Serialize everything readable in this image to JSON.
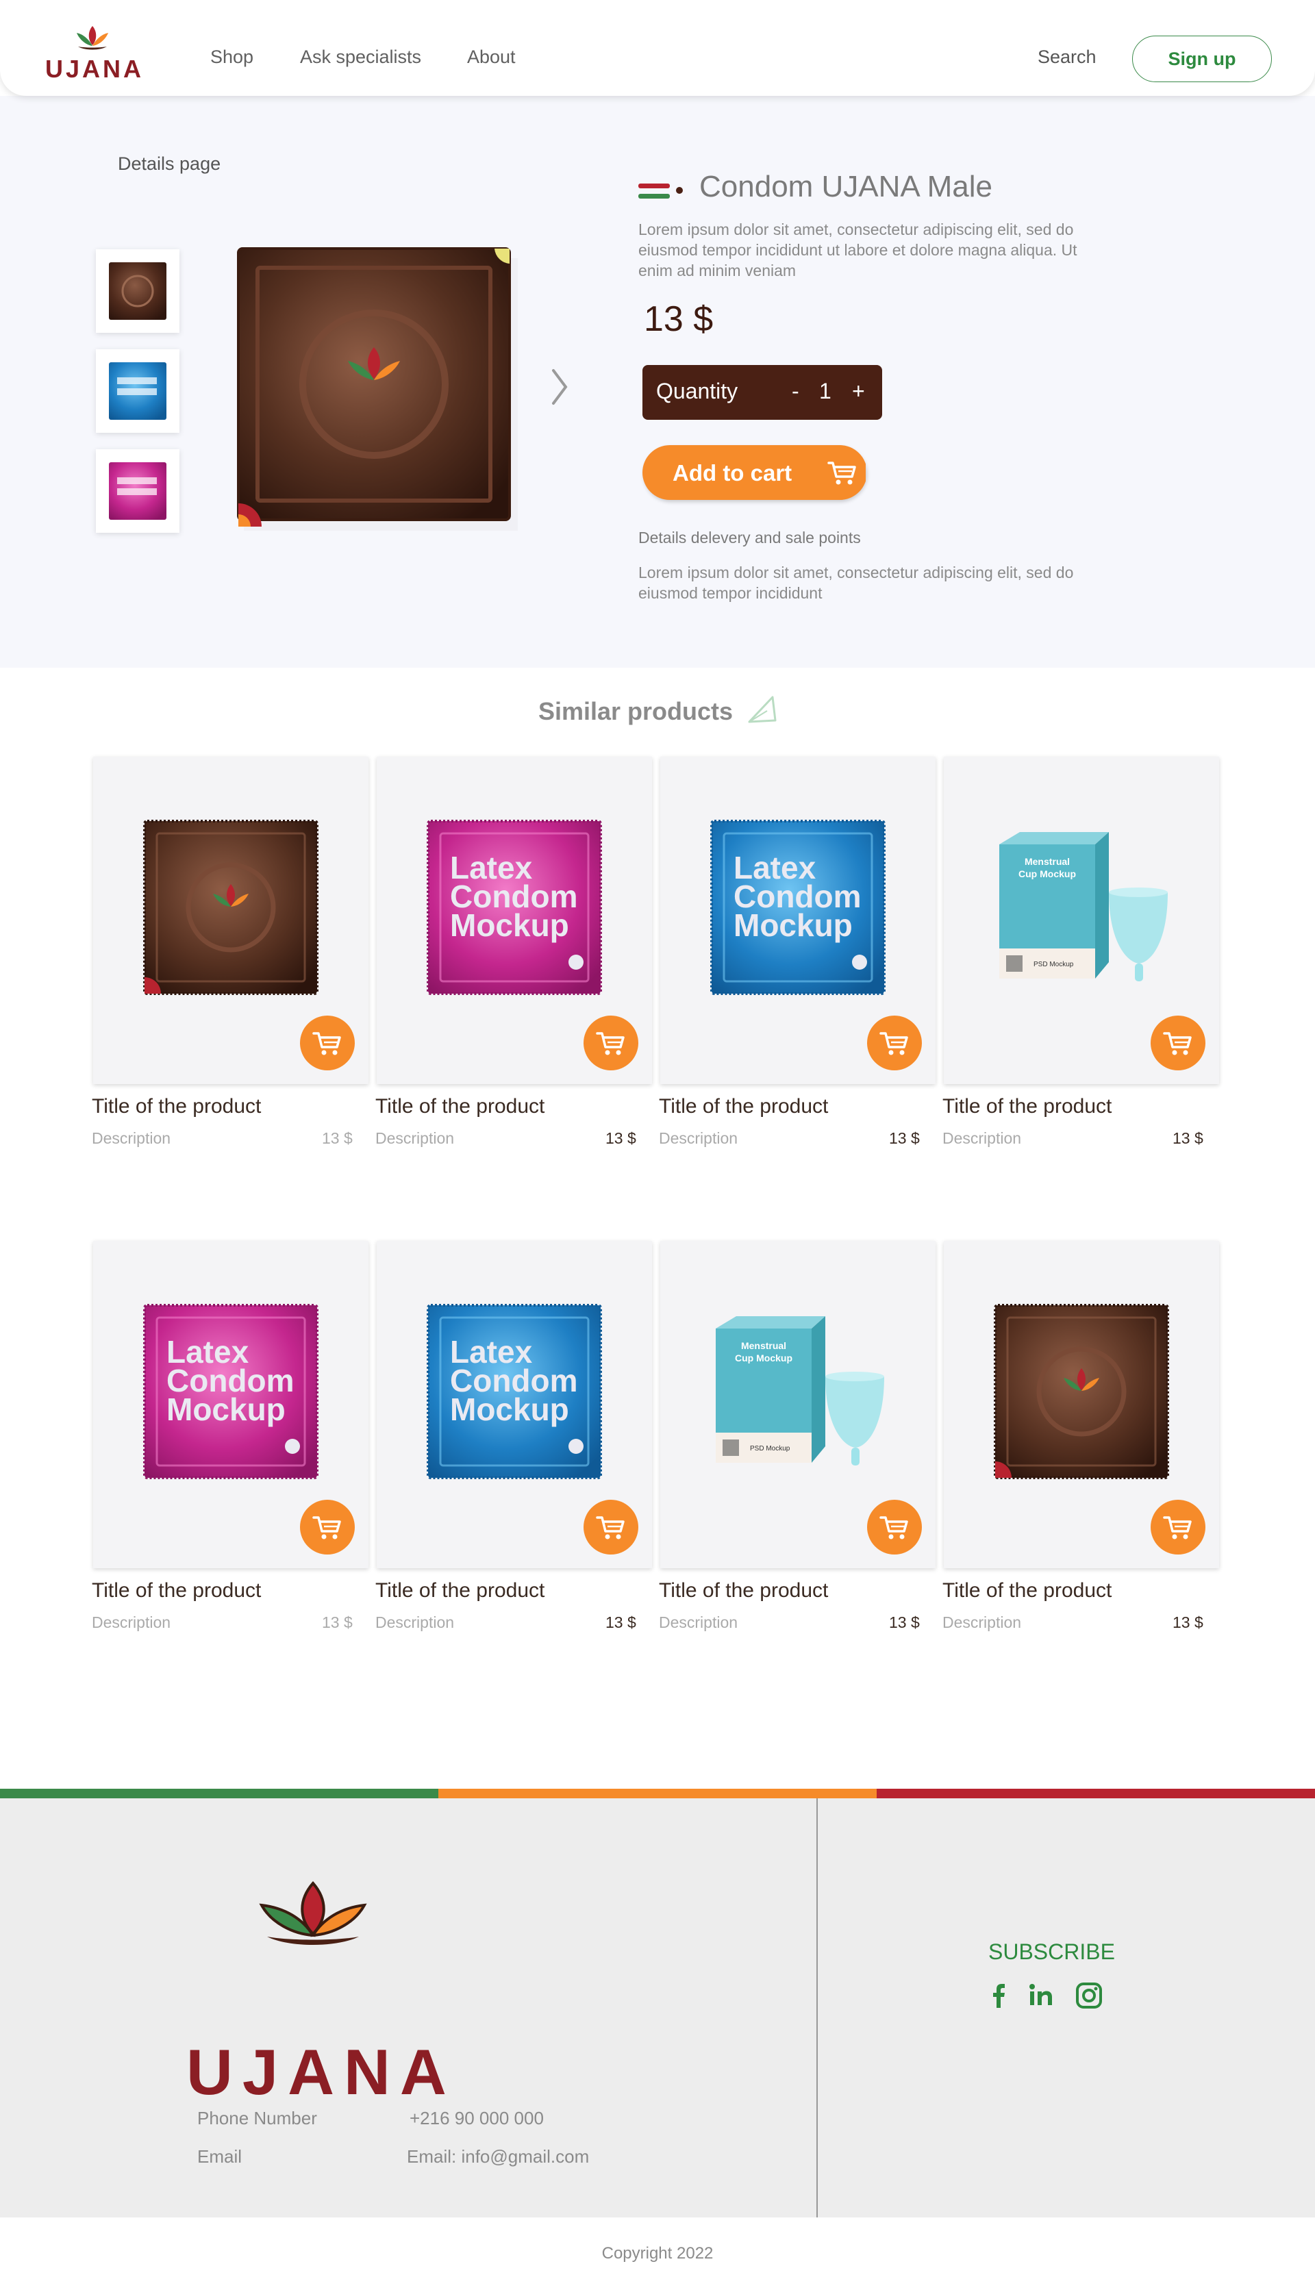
{
  "brand": "UJANA",
  "header": {
    "nav": [
      {
        "label": "Shop"
      },
      {
        "label": "Ask specialists"
      },
      {
        "label": "About"
      }
    ],
    "search_label": "Search",
    "signup_label": "Sign up"
  },
  "details": {
    "breadcrumb": "Details page",
    "title": "Condom UJANA Male",
    "description": "Lorem ipsum dolor sit amet, consectetur adipiscing elit, sed do eiusmod tempor incididunt ut labore et dolore magna aliqua. Ut enim ad minim veniam",
    "price": "13 $",
    "quantity": {
      "label": "Quantity",
      "minus": "-",
      "value": "1",
      "plus": "+"
    },
    "add_to_cart": "Add to cart",
    "delivery_heading": "Details delevery and sale points",
    "delivery_text": "Lorem ipsum dolor sit amet, consectetur adipiscing elit, sed do eiusmod tempor incididunt"
  },
  "similar": {
    "heading": "Similar products",
    "products": [
      {
        "title": "Title of the product",
        "description": "Description",
        "price": "13 $",
        "kind": "brown-condom"
      },
      {
        "title": "Title of the product",
        "description": "Description",
        "price": "13 $",
        "kind": "pink-condom"
      },
      {
        "title": "Title of the product",
        "description": "Description",
        "price": "13 $",
        "kind": "blue-condom"
      },
      {
        "title": "Title of the product",
        "description": "Description",
        "price": "13 $",
        "kind": "menstrual-cup"
      },
      {
        "title": "Title of the product",
        "description": "Description",
        "price": "13 $",
        "kind": "pink-condom"
      },
      {
        "title": "Title of the product",
        "description": "Description",
        "price": "13 $",
        "kind": "blue-condom"
      },
      {
        "title": "Title of the product",
        "description": "Description",
        "price": "13 $",
        "kind": "menstrual-cup"
      },
      {
        "title": "Title of the product",
        "description": "Description",
        "price": "13 $",
        "kind": "brown-condom"
      }
    ]
  },
  "package_text": {
    "latex": [
      "Latex",
      "Condom",
      "Mockup"
    ],
    "cup": [
      "Menstrual",
      "Cup Mockup"
    ],
    "psd": "PSD Mockup"
  },
  "footer": {
    "phone_label": "Phone Number",
    "phone_value": "+216 90 000 000",
    "email_label": "Email",
    "email_value": "Email: info@gmail.com",
    "subscribe": "SUBSCRIBE",
    "copyright": "Copyright 2022"
  },
  "colors": {
    "accent": "#f68b2a",
    "brand_green": "#2d8a3e",
    "brand_red": "#b8232f",
    "dark_brown": "#4a2014",
    "stripe": [
      "#3b8a4a",
      "#f68b2a",
      "#b8232f"
    ]
  },
  "icons": [
    "cart-icon",
    "chevron-right-icon",
    "facebook-icon",
    "linkedin-icon",
    "instagram-icon",
    "leaf-icon",
    "flag-icon"
  ]
}
